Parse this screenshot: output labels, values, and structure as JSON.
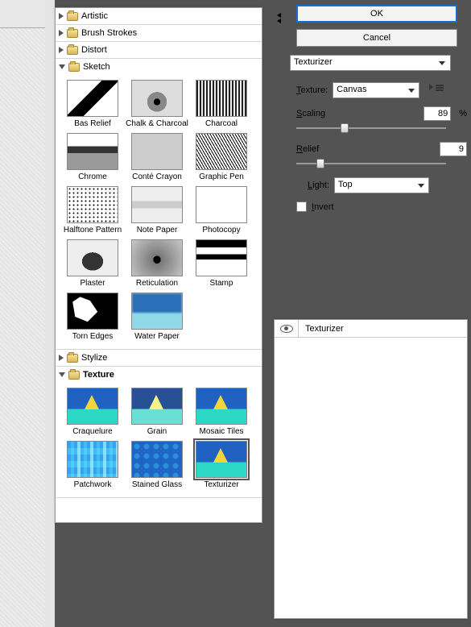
{
  "buttons": {
    "ok": "OK",
    "cancel": "Cancel"
  },
  "filter_dropdown": "Texturizer",
  "settings": {
    "texture_label": "Texture:",
    "texture_value": "Canvas",
    "scaling_label": "Scaling",
    "scaling_value": "89",
    "scaling_pct": "%",
    "relief_label": "Relief",
    "relief_value": "9",
    "light_label": "Light:",
    "light_value": "Top",
    "invert_label": "Invert"
  },
  "layers": {
    "row0": "Texturizer"
  },
  "categories": {
    "artistic": "Artistic",
    "brush": "Brush Strokes",
    "distort": "Distort",
    "sketch": "Sketch",
    "stylize": "Stylize",
    "texture": "Texture"
  },
  "sketch_items": {
    "0": "Bas Relief",
    "1": "Chalk & Charcoal",
    "2": "Charcoal",
    "3": "Chrome",
    "4": "Conté Crayon",
    "5": "Graphic Pen",
    "6": "Halftone Pattern",
    "7": "Note Paper",
    "8": "Photocopy",
    "9": "Plaster",
    "10": "Reticulation",
    "11": "Stamp",
    "12": "Torn Edges",
    "13": "Water Paper"
  },
  "texture_items": {
    "0": "Craquelure",
    "1": "Grain",
    "2": "Mosaic Tiles",
    "3": "Patchwork",
    "4": "Stained Glass",
    "5": "Texturizer"
  }
}
